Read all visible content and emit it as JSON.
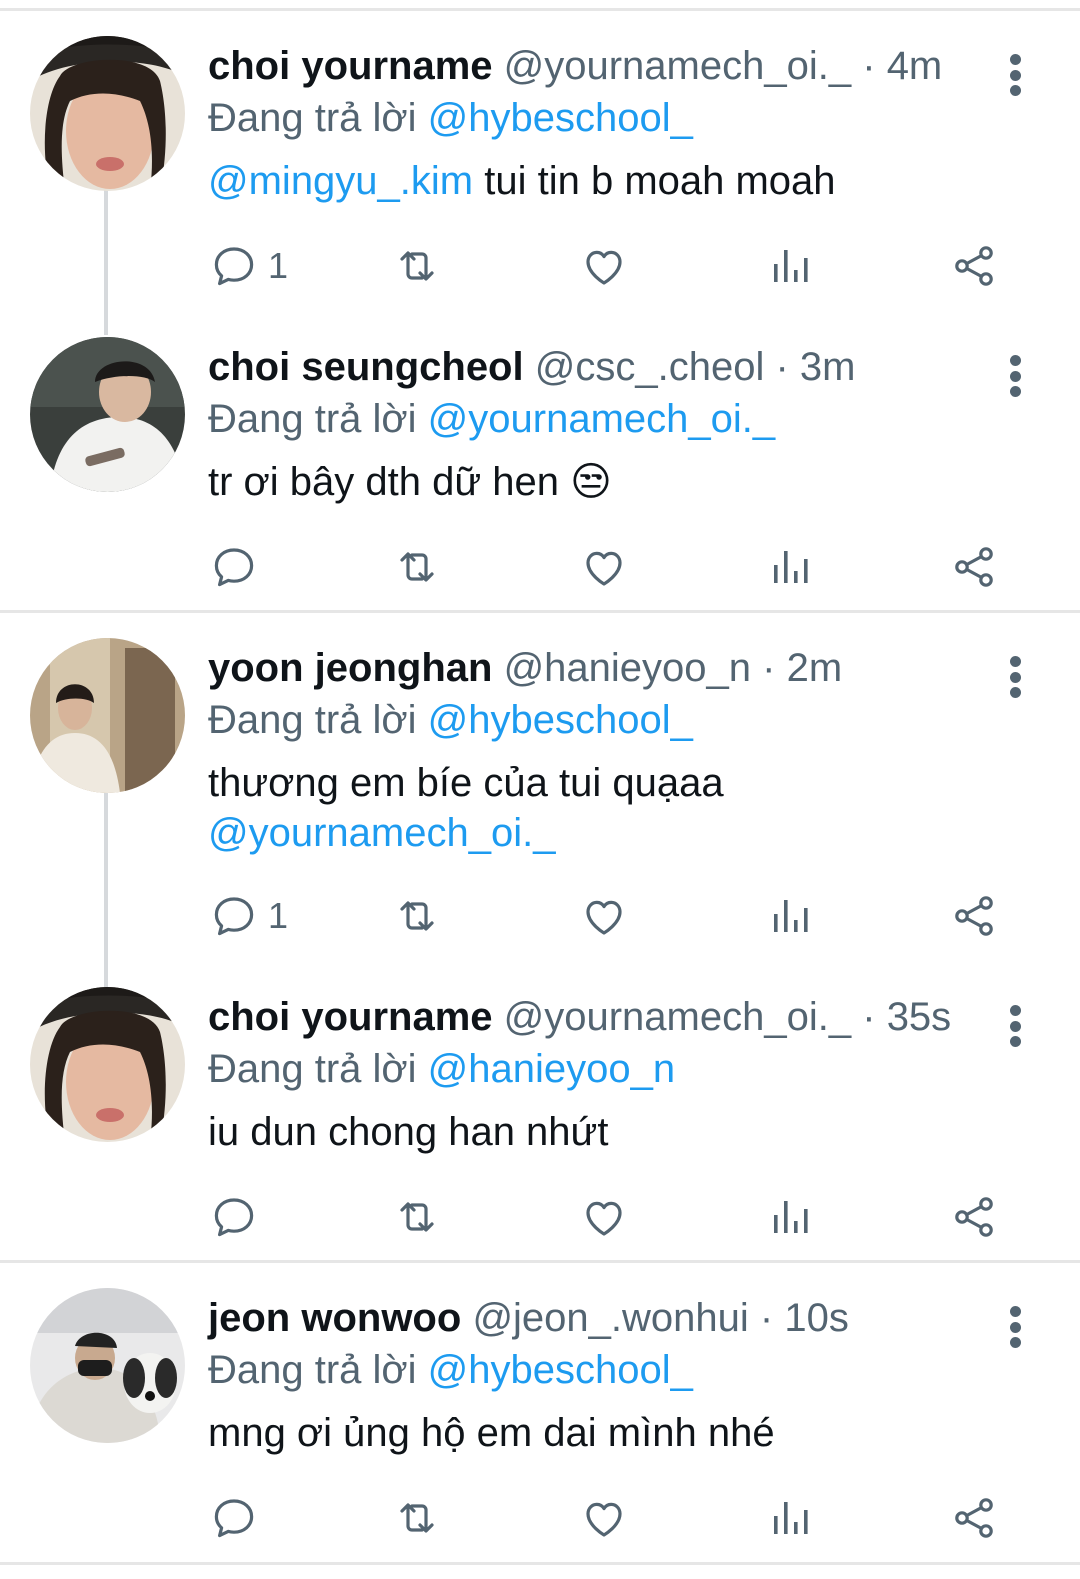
{
  "tweets": [
    {
      "name": "choi yourname",
      "handle": "@yournamech_oi._",
      "time": "4m",
      "replying_label": "Đang trả lời",
      "replying_to": "@hybeschool_",
      "body_mention": "@mingyu_.kim",
      "body": " tui tin b moah moah",
      "reply_count": "1",
      "avatar": "avatar-girl-cap"
    },
    {
      "name": "choi seungcheol",
      "handle": "@csc_.cheol",
      "time": "3m",
      "replying_label": "Đang trả lời",
      "replying_to": "@yournamech_oi._",
      "body": "tr ơi bây dth dữ hen",
      "emoji": "😒",
      "reply_count": "",
      "avatar": "avatar-boy-writing"
    },
    {
      "name": "yoon jeonghan",
      "handle": "@hanieyoo_n",
      "time": "2m",
      "replying_label": "Đang trả lời",
      "replying_to": "@hybeschool_",
      "body": "thương em bíe của tui quạaa",
      "body_mention2": "@yournamech_oi._",
      "reply_count": "1",
      "avatar": "avatar-hallway"
    },
    {
      "name": "choi yourname",
      "handle": "@yournamech_oi._",
      "time": "35s",
      "replying_label": "Đang trả lời",
      "replying_to": "@hanieyoo_n",
      "body": "iu dun chong han nhứt",
      "reply_count": "",
      "avatar": "avatar-girl-cap"
    },
    {
      "name": "jeon wonwoo",
      "handle": "@jeon_.wonhui",
      "time": "10s",
      "replying_label": "Đang trả lời",
      "replying_to": "@hybeschool_",
      "body": "mng ơi ủng hộ em dai mình nhé",
      "reply_count": "",
      "avatar": "avatar-dog"
    }
  ],
  "separator": "·",
  "icons": [
    "reply-icon",
    "retweet-icon",
    "like-icon",
    "views-icon",
    "share-icon",
    "more-icon"
  ],
  "colors": {
    "accent": "#1d9bf0",
    "muted": "#536471",
    "text": "#0f1419"
  }
}
